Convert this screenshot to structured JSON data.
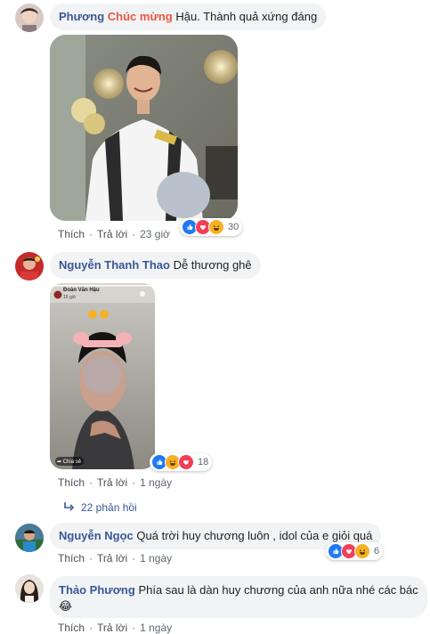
{
  "comments": [
    {
      "author": "Phương",
      "highlight": "Chúc mừng",
      "text": " Hậu. Thành quả xứng đáng",
      "like": "Thích",
      "reply": "Trả lời",
      "time": "23 giờ",
      "reaction_count": "30",
      "reactions": [
        "like-icon",
        "love-icon",
        "haha-icon"
      ]
    },
    {
      "author": "Nguyễn Thanh Thao",
      "text": "Dễ thương ghê",
      "like": "Thích",
      "reply": "Trả lời",
      "time": "1 ngày",
      "reaction_count": "18",
      "reactions": [
        "like-icon",
        "haha-icon",
        "love-icon"
      ],
      "story": {
        "user": "Đoàn Văn Hậu",
        "time": "15 giờ",
        "share": "Chia sẻ"
      },
      "replies_label": "22 phản hồi"
    },
    {
      "author": "Nguyễn Ngọc",
      "text": "Quá trời huy chương luôn , idol của e giỏi quá",
      "like": "Thích",
      "reply": "Trả lời",
      "time": "1 ngày",
      "reaction_count": "6",
      "reactions": [
        "like-icon",
        "love-icon",
        "haha-icon"
      ]
    },
    {
      "author": "Thảo Phương",
      "text": "Phía sau là dàn huy chương của anh nữa nhé các bác",
      "emoji": "😂",
      "like": "Thích",
      "reply": "Trả lời",
      "time": "1 ngày"
    }
  ],
  "colors": {
    "name": "#385898",
    "highlight": "#e9573f",
    "bubble": "#f2f3f5",
    "like": "#2078f4",
    "love": "#f33e58",
    "haha": "#f7b125"
  }
}
